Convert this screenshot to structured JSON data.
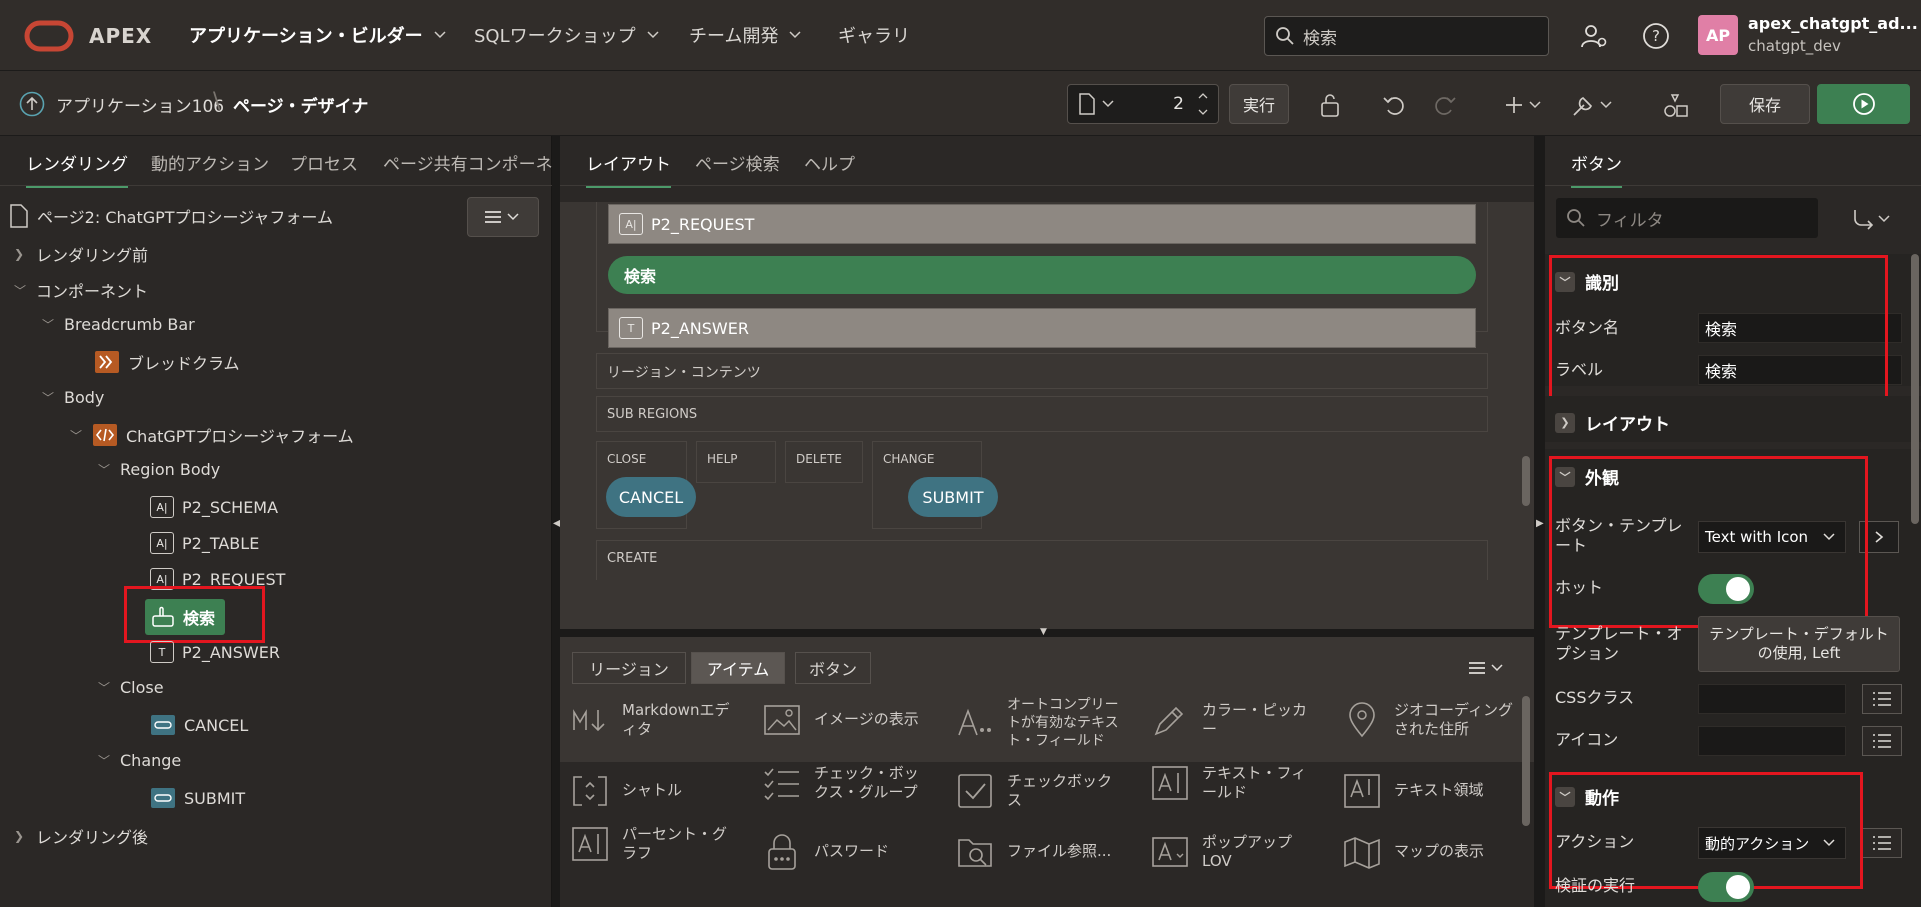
{
  "topbar": {
    "brand": "APEX",
    "nav": [
      {
        "label": "アプリケーション・ビルダー",
        "has_menu": true
      },
      {
        "label": "SQLワークショップ",
        "has_menu": true
      },
      {
        "label": "チーム開発",
        "has_menu": true
      },
      {
        "label": "ギャラリ",
        "has_menu": false
      }
    ],
    "search_placeholder": "検索",
    "user": {
      "initials": "AP",
      "name": "apex_chatgpt_ad...",
      "workspace": "chatgpt_dev",
      "avatar_color": "#e07fa6"
    }
  },
  "subbar": {
    "breadcrumb_app": "アプリケーション106",
    "breadcrumb_page": "ページ・デザイナ",
    "page_number": "2",
    "run_label": "実行",
    "save_label": "保存"
  },
  "left": {
    "tabs": [
      "レンダリング",
      "動的アクション",
      "プロセス",
      "ページ共有コンポーネン"
    ],
    "page_title": "ページ2: ChatGPTプロシージャフォーム",
    "tree": {
      "before": "レンダリング前",
      "components": "コンポーネント",
      "breadcrumb_bar": "Breadcrumb Bar",
      "breadcrumb": "ブレッドクラム",
      "body": "Body",
      "region": "ChatGPTプロシージャフォーム",
      "region_body": "Region Body",
      "items": [
        "P2_SCHEMA",
        "P2_TABLE",
        "P2_REQUEST"
      ],
      "selected_button": "検索",
      "answer": "P2_ANSWER",
      "close": "Close",
      "cancel": "CANCEL",
      "change": "Change",
      "submit": "SUBMIT",
      "after": "レンダリング後"
    }
  },
  "center": {
    "tabs": [
      "レイアウト",
      "ページ検索",
      "ヘルプ"
    ],
    "canvas": {
      "request_item": "P2_REQUEST",
      "search_button": "検索",
      "answer_item": "P2_ANSWER",
      "region_contents": "リージョン・コンテンツ",
      "sub_regions": "SUB REGIONS",
      "positions": [
        "CLOSE",
        "HELP",
        "DELETE",
        "CHANGE"
      ],
      "cancel_button": "CANCEL",
      "submit_button": "SUBMIT",
      "create": "CREATE"
    },
    "gallery_tabs": [
      "リージョン",
      "アイテム",
      "ボタン"
    ],
    "gallery_items": [
      [
        "Markdownエディタ",
        "イメージの表示",
        "オートコンプリートが有効なテキスト・フィールド",
        "カラー・ピッカー",
        "ジオコーディングされた住所"
      ],
      [
        "シャトル",
        "チェック・ボックス・グループ",
        "チェックボックス",
        "テキスト・フィールド",
        "テキスト領域"
      ],
      [
        "パーセント・グラフ",
        "パスワード",
        "ファイル参照...",
        "ポップアップLOV",
        "マップの表示"
      ]
    ]
  },
  "right": {
    "tab": "ボタン",
    "filter_placeholder": "フィルタ",
    "sections": {
      "identification": "識別",
      "layout": "レイアウト",
      "appearance": "外観",
      "behavior": "動作"
    },
    "props": {
      "button_name_label": "ボタン名",
      "button_name_value": "検索",
      "label_label": "ラベル",
      "label_value": "検索",
      "template_label": "ボタン・テンプレート",
      "template_value": "Text with Icon",
      "hot_label": "ホット",
      "template_options_label": "テンプレート・オプション",
      "template_options_value": "テンプレート・デフォルトの使用, Left",
      "css_label": "CSSクラス",
      "icon_label": "アイコン",
      "action_label": "アクション",
      "action_value": "動的アクション",
      "validate_label": "検証の実行"
    }
  },
  "colors": {
    "accent": "#3d8052",
    "highlight": "#e3161f",
    "oracle_red": "#c74634"
  }
}
